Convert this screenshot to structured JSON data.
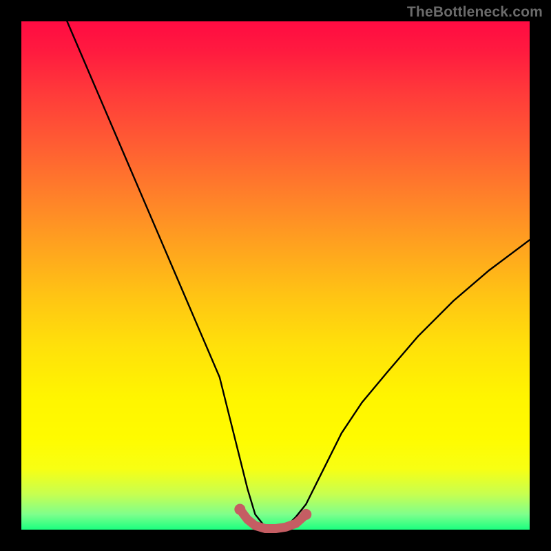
{
  "watermark": "TheBottleneck.com",
  "chart_data": {
    "type": "line",
    "title": "",
    "xlabel": "",
    "ylabel": "",
    "xlim": [
      0,
      100
    ],
    "ylim": [
      0,
      100
    ],
    "background_gradient": {
      "top": "#ff0b42",
      "bottom": "#1bff7f"
    },
    "series": [
      {
        "name": "bottleneck-curve",
        "stroke": "#000000",
        "x": [
          9,
          12,
          15,
          18,
          21,
          24,
          27,
          30,
          33,
          36,
          39,
          41,
          43,
          44.5,
          46,
          48,
          50,
          52,
          54,
          56,
          58,
          60,
          63,
          67,
          72,
          78,
          85,
          92,
          100
        ],
        "y": [
          100,
          93,
          86,
          79,
          72,
          65,
          58,
          51,
          44,
          37,
          30,
          22,
          14,
          8,
          3,
          0.5,
          0,
          0.5,
          2.5,
          5,
          9,
          13,
          19,
          25,
          31,
          38,
          45,
          51,
          57
        ]
      },
      {
        "name": "highlight-bottom",
        "stroke": "#c55d63",
        "stroke_width": 12,
        "dots": true,
        "x": [
          43.0,
          44.5,
          46.0,
          48.0,
          50.0,
          52.0,
          54.0,
          56.0
        ],
        "y": [
          4.0,
          2.0,
          0.8,
          0.2,
          0.2,
          0.5,
          1.2,
          3.0
        ]
      }
    ]
  }
}
